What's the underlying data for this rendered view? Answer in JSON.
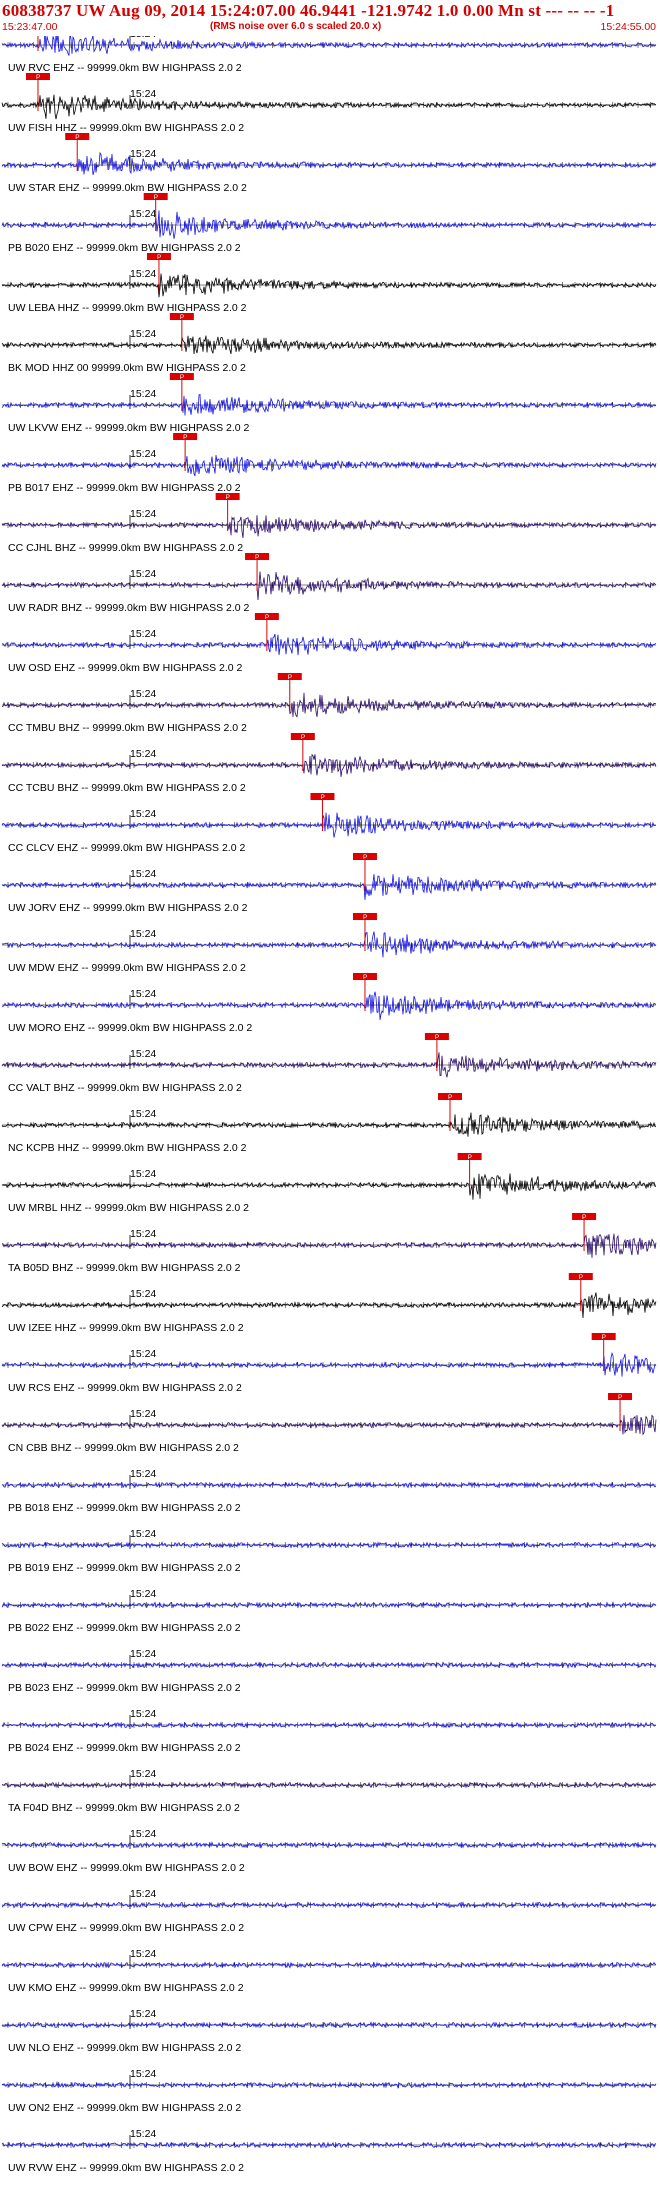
{
  "header": {
    "title": "60838737 UW Aug 09, 2014 15:24:07.00   46.9441 -121.9742  1.0 0.00 Mn st --- -- --   -1",
    "start_time": "15:23:47.00",
    "note": "(RMS noise over 6.0 s scaled 20.0 x)",
    "end_time": "15:24:55.00"
  },
  "tick_label": "15:24",
  "pick_label": "P",
  "colors": {
    "blue": "#1414e6",
    "purple": "#2a0a6e",
    "black": "#000000",
    "pick": "#dd0000"
  },
  "traces": [
    {
      "label": "UW RVC EHZ -- 99999.0km BW HIGHPASS  2.0  2",
      "color": "blue",
      "pick": 0.055
    },
    {
      "label": "UW FISH HHZ -- 99999.0km BW HIGHPASS  2.0  2",
      "color": "black",
      "pick": 0.055
    },
    {
      "label": "UW STAR EHZ -- 99999.0km BW HIGHPASS  2.0  2",
      "color": "blue",
      "pick": 0.115
    },
    {
      "label": "PB B020 EHZ -- 99999.0km BW HIGHPASS  2.0  2",
      "color": "blue",
      "pick": 0.235
    },
    {
      "label": "UW LEBA HHZ -- 99999.0km BW HIGHPASS  2.0  2",
      "color": "black",
      "pick": 0.24
    },
    {
      "label": "BK MOD HHZ 00 99999.0km BW HIGHPASS  2.0  2",
      "color": "black",
      "pick": 0.275
    },
    {
      "label": "UW LKVW EHZ -- 99999.0km BW HIGHPASS  2.0  2",
      "color": "blue",
      "pick": 0.275
    },
    {
      "label": "PB B017 EHZ -- 99999.0km BW HIGHPASS  2.0  2",
      "color": "blue",
      "pick": 0.28
    },
    {
      "label": "CC CJHL BHZ -- 99999.0km BW HIGHPASS  2.0  2",
      "color": "purple",
      "pick": 0.345
    },
    {
      "label": "UW RADR BHZ -- 99999.0km BW HIGHPASS  2.0  2",
      "color": "purple",
      "pick": 0.39
    },
    {
      "label": "UW OSD EHZ -- 99999.0km BW HIGHPASS  2.0  2",
      "color": "blue",
      "pick": 0.405
    },
    {
      "label": "CC TMBU BHZ -- 99999.0km BW HIGHPASS  2.0  2",
      "color": "purple",
      "pick": 0.44
    },
    {
      "label": "CC TCBU BHZ -- 99999.0km BW HIGHPASS  2.0  2",
      "color": "purple",
      "pick": 0.46
    },
    {
      "label": "CC CLCV EHZ -- 99999.0km BW HIGHPASS  2.0  2",
      "color": "blue",
      "pick": 0.49
    },
    {
      "label": "UW JORV EHZ -- 99999.0km BW HIGHPASS  2.0  2",
      "color": "blue",
      "pick": 0.555
    },
    {
      "label": "UW MDW EHZ -- 99999.0km BW HIGHPASS  2.0  2",
      "color": "blue",
      "pick": 0.555
    },
    {
      "label": "UW MORO EHZ -- 99999.0km BW HIGHPASS  2.0  2",
      "color": "blue",
      "pick": 0.555
    },
    {
      "label": "CC VALT BHZ -- 99999.0km BW HIGHPASS  2.0  2",
      "color": "purple",
      "pick": 0.665
    },
    {
      "label": "NC KCPB HHZ -- 99999.0km BW HIGHPASS  2.0  2",
      "color": "black",
      "pick": 0.685
    },
    {
      "label": "UW MRBL HHZ -- 99999.0km BW HIGHPASS  2.0  2",
      "color": "black",
      "pick": 0.715
    },
    {
      "label": "TA B05D BHZ -- 99999.0km BW HIGHPASS  2.0  2",
      "color": "purple",
      "pick": 0.89
    },
    {
      "label": "UW IZEE HHZ -- 99999.0km BW HIGHPASS  2.0  2",
      "color": "black",
      "pick": 0.885
    },
    {
      "label": "UW RCS EHZ -- 99999.0km BW HIGHPASS  2.0  2",
      "color": "blue",
      "pick": 0.92
    },
    {
      "label": "CN CBB BHZ -- 99999.0km BW HIGHPASS  2.0  2",
      "color": "purple",
      "pick": 0.945
    },
    {
      "label": "PB B018 EHZ -- 99999.0km BW HIGHPASS  2.0  2",
      "color": "blue",
      "pick": null
    },
    {
      "label": "PB B019 EHZ -- 99999.0km BW HIGHPASS  2.0  2",
      "color": "blue",
      "pick": null
    },
    {
      "label": "PB B022 EHZ -- 99999.0km BW HIGHPASS  2.0  2",
      "color": "blue",
      "pick": null
    },
    {
      "label": "PB B023 EHZ -- 99999.0km BW HIGHPASS  2.0  2",
      "color": "blue",
      "pick": null
    },
    {
      "label": "PB B024 EHZ -- 99999.0km BW HIGHPASS  2.0  2",
      "color": "blue",
      "pick": null
    },
    {
      "label": "TA F04D BHZ -- 99999.0km BW HIGHPASS  2.0  2",
      "color": "purple",
      "pick": null
    },
    {
      "label": "UW BOW EHZ -- 99999.0km BW HIGHPASS  2.0  2",
      "color": "blue",
      "pick": null
    },
    {
      "label": "UW CPW EHZ -- 99999.0km BW HIGHPASS  2.0  2",
      "color": "blue",
      "pick": null
    },
    {
      "label": "UW KMO EHZ -- 99999.0km BW HIGHPASS  2.0  2",
      "color": "blue",
      "pick": null
    },
    {
      "label": "UW NLO EHZ -- 99999.0km BW HIGHPASS  2.0  2",
      "color": "blue",
      "pick": null
    },
    {
      "label": "UW ON2 EHZ -- 99999.0km BW HIGHPASS  2.0  2",
      "color": "blue",
      "pick": null
    },
    {
      "label": "UW RVW EHZ -- 99999.0km BW HIGHPASS  2.0  2",
      "color": "blue",
      "pick": null
    }
  ]
}
